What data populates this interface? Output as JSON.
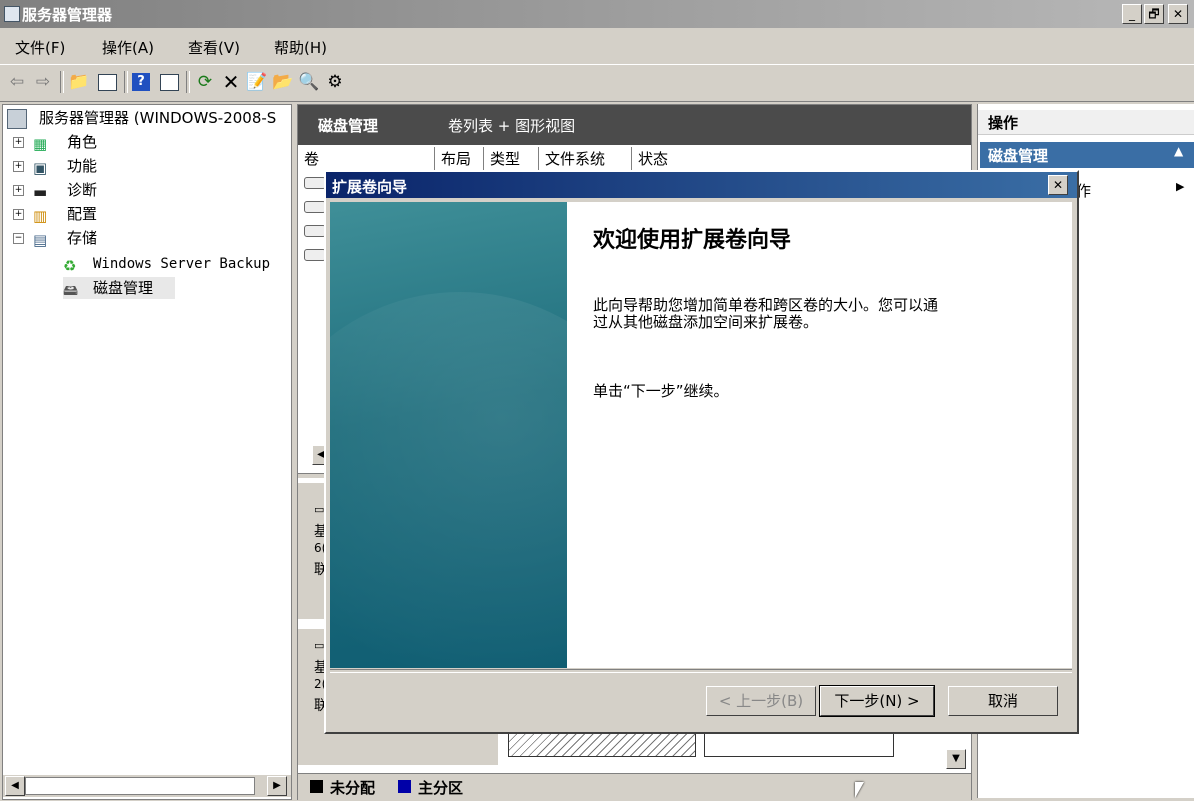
{
  "window": {
    "title": "服务器管理器",
    "controls": [
      "_",
      "🗗",
      "✕"
    ]
  },
  "menu": [
    "文件(F)",
    "操作(A)",
    "查看(V)",
    "帮助(H)"
  ],
  "tree": {
    "root": "服务器管理器 (WINDOWS-2008-S",
    "items": [
      {
        "label": "角色",
        "expander": "+"
      },
      {
        "label": "功能",
        "expander": "+"
      },
      {
        "label": "诊断",
        "expander": "+"
      },
      {
        "label": "配置",
        "expander": "+"
      },
      {
        "label": "存储",
        "expander": "−"
      }
    ],
    "children": [
      "Windows Server Backup",
      "磁盘管理"
    ]
  },
  "center": {
    "title": "磁盘管理",
    "subtitle": "卷列表 + 图形视图",
    "columns": [
      "卷",
      "布局",
      "类型",
      "文件系统",
      "状态"
    ],
    "disk_rows": [
      {
        "a": "基",
        "b": "6(",
        "c": "联"
      },
      {
        "a": "基",
        "b": "2(",
        "c": "联"
      }
    ],
    "legend": [
      {
        "label": "未分配",
        "color": "#000000"
      },
      {
        "label": "主分区",
        "color": "#0000a8"
      }
    ]
  },
  "actions": {
    "header": "操作",
    "section": "磁盘管理",
    "item": "作"
  },
  "wizard": {
    "title": "扩展卷向导",
    "heading": "欢迎使用扩展卷向导",
    "description_line1": "此向导帮助您增加简单卷和跨区卷的大小。您可以通",
    "description_line2": "过从其他磁盘添加空间来扩展卷。",
    "instruction": "单击“下一步”继续。",
    "buttons": {
      "back": "< 上一步(B)",
      "next": "下一步(N) >",
      "cancel": "取消"
    },
    "close": "✕"
  }
}
